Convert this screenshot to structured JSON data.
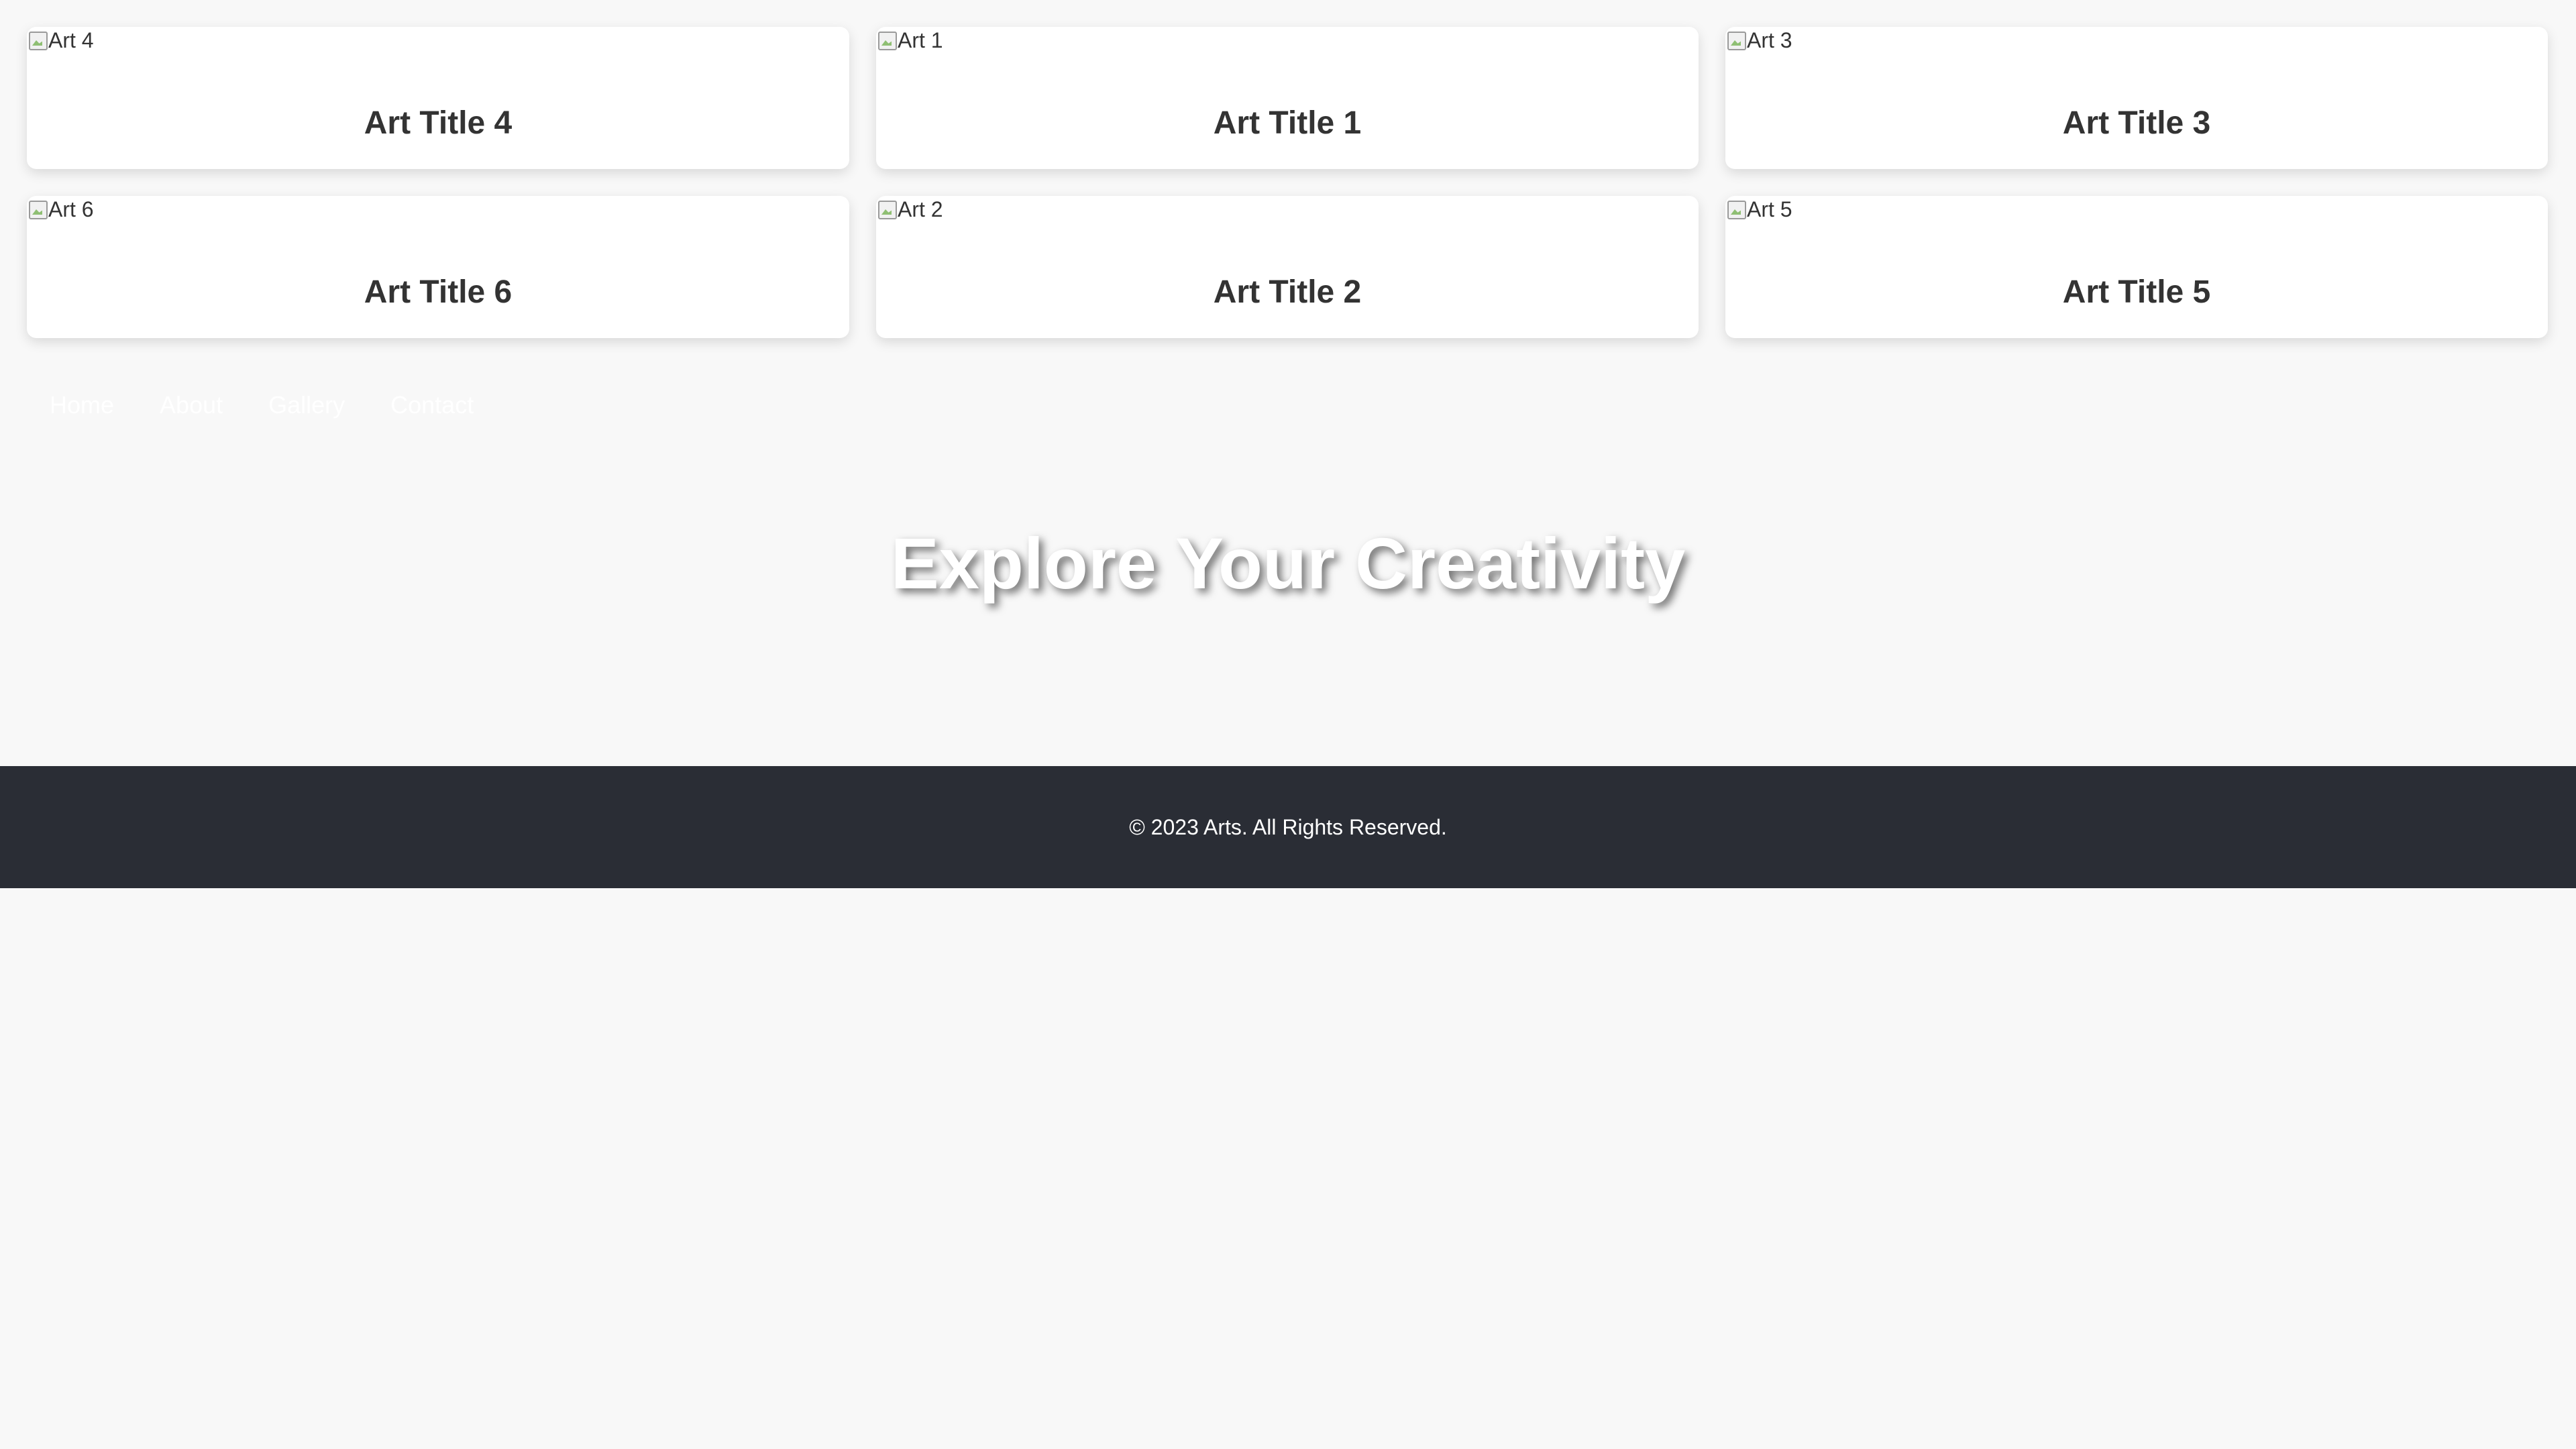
{
  "gallery": {
    "cards": [
      {
        "alt": "Art 4",
        "title": "Art Title 4"
      },
      {
        "alt": "Art 1",
        "title": "Art Title 1"
      },
      {
        "alt": "Art 3",
        "title": "Art Title 3"
      },
      {
        "alt": "Art 6",
        "title": "Art Title 6"
      },
      {
        "alt": "Art 2",
        "title": "Art Title 2"
      },
      {
        "alt": "Art 5",
        "title": "Art Title 5"
      }
    ]
  },
  "nav": {
    "items": [
      "Home",
      "About",
      "Gallery",
      "Contact"
    ]
  },
  "hero": {
    "title": "Explore Your Creativity"
  },
  "footer": {
    "text": "© 2023 Arts. All Rights Reserved."
  },
  "colors": {
    "background": "#f8f8f8",
    "card": "#ffffff",
    "title_text": "#333333",
    "footer_bg": "#2a2d35",
    "footer_text": "#ffffff"
  }
}
